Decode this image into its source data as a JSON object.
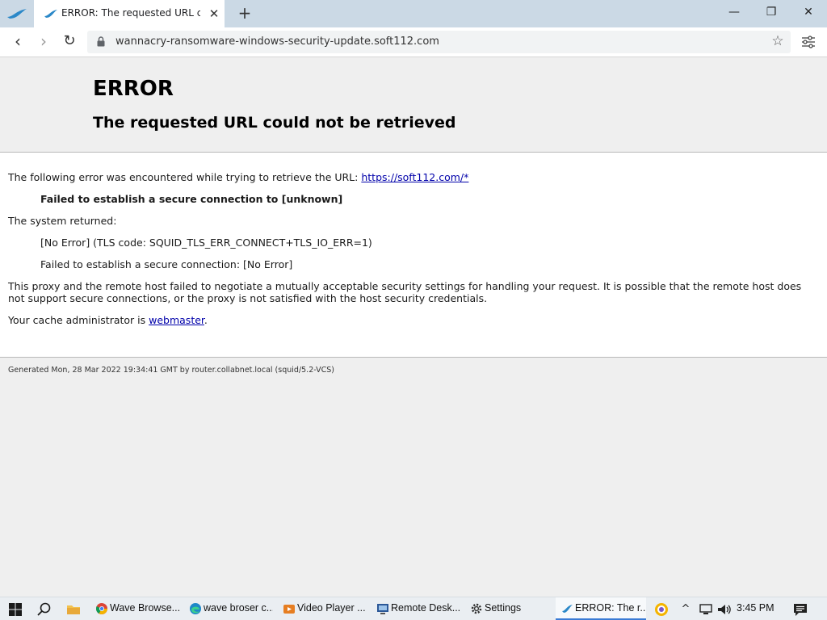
{
  "browser": {
    "tab_title": "ERROR: The requested URL could not be retrieved",
    "tab_close": "✕",
    "new_tab": "+",
    "window_minimize": "—",
    "window_restore": "❐",
    "window_close": "✕",
    "url": "wannacry-ransomware-windows-security-update.soft112.com",
    "back_glyph": "‹",
    "forward_glyph": "›",
    "reload_glyph": "↻",
    "bookmark_glyph": "☆",
    "brand_color": "#2b88c8"
  },
  "page": {
    "title": "ERROR",
    "subtitle": "The requested URL could not be retrieved",
    "intro_text": "The following error was encountered while trying to retrieve the URL: ",
    "intro_link": "https://soft112.com/*",
    "error_summary": "Failed to establish a secure connection to [unknown]",
    "system_returned_label": "The system returned:",
    "system_error_1": "[No Error] (TLS code: SQUID_TLS_ERR_CONNECT+TLS_IO_ERR=1)",
    "system_error_2": "Failed to establish a secure connection: [No Error]",
    "explanation": "This proxy and the remote host failed to negotiate a mutually acceptable security settings for handling your request. It is possible that the remote host does not support secure connections, or the proxy is not satisfied with the host security credentials.",
    "admin_prefix": "Your cache administrator is ",
    "admin_link": "webmaster",
    "admin_suffix": ".",
    "footer": "Generated Mon, 28 Mar 2022 19:34:41 GMT by router.collabnet.local (squid/5.2-VCS)"
  },
  "taskbar": {
    "items": [
      {
        "label": "Wave Browse...",
        "icon": "chrome-icon"
      },
      {
        "label": "wave broser c...",
        "icon": "edge-icon"
      },
      {
        "label": "Video Player ...",
        "icon": "video-player-icon"
      },
      {
        "label": "Remote Desk...",
        "icon": "remote-desktop-icon"
      },
      {
        "label": "Settings",
        "icon": "gear-icon"
      },
      {
        "label": "ERROR: The r...",
        "icon": "wave-browser-icon"
      }
    ],
    "tray_chevron": "^",
    "time": "3:45 PM"
  }
}
